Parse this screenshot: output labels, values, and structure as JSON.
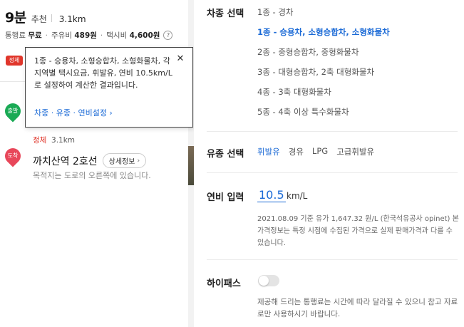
{
  "route_summary": {
    "duration": "9분",
    "recommend_label": "추천",
    "distance": "3.1km",
    "toll_label": "통행료",
    "toll_value": "무료",
    "fuel_label": "주유비",
    "fuel_value": "489원",
    "taxi_label": "택시비",
    "taxi_value": "4,600원"
  },
  "traffic_badge": "정체",
  "tooltip": {
    "text": "1종 - 승용차, 소형승합차, 소형화물차, 각 지역별 택시요금, 휘발유, 연비 10.5km/L로 설정하여 계산한 결과입니다.",
    "link": "차종 · 유종 · 연비설정 ›"
  },
  "route": {
    "start_pin": "출발",
    "end_pin": "도착",
    "segment_status": "정체",
    "segment_distance": "3.1km",
    "destination_name": "까치산역 2호선",
    "detail_button": "상세정보",
    "destination_desc": "목적지는 도로의 오른쪽에 있습니다."
  },
  "settings": {
    "car_type": {
      "label": "차종 선택",
      "options": [
        "1종 - 경차",
        "1종 - 승용차, 소형승합차, 소형화물차",
        "2종 - 중형승합차, 중형화물차",
        "3종 - 대형승합차, 2축 대형화물차",
        "4종 - 3축 대형화물차",
        "5종 - 4축 이상 특수화물차"
      ],
      "selected_index": 1
    },
    "fuel_type": {
      "label": "유종 선택",
      "options": [
        "휘발유",
        "경유",
        "LPG",
        "고급휘발유"
      ],
      "selected_index": 0
    },
    "efficiency": {
      "label": "연비 입력",
      "value": "10.5",
      "unit": "km/L",
      "note": "2021.08.09 기준 유가 1,647.32 원/L (한국석유공사 opinet) 본 가격정보는 특정 시점에 수집된 가격으로 실제 판매가격과 다를 수 있습니다."
    },
    "hipass": {
      "label": "하이패스",
      "enabled": false,
      "note": "제공해 드리는 통행료는 시간에 따라 달라질 수 있으니 참고 자료로만 사용하시기 바랍니다."
    }
  },
  "colors": {
    "accent": "#1b6ad6",
    "jam": "#e0362b",
    "start_pin": "#1aaa55",
    "end_pin": "#e8475a"
  }
}
